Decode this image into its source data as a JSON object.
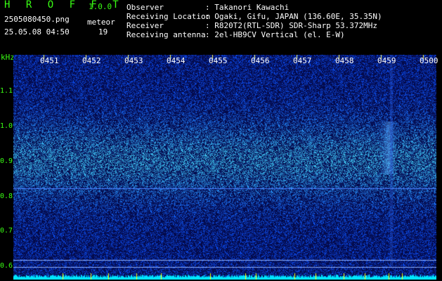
{
  "header": {
    "app_title": "H R O F F T",
    "app_version": "1.0.0",
    "file_name": "2505080450.png",
    "timestamp": "25.05.08 04:50",
    "meteor_label": "meteor",
    "meteor_count": "19"
  },
  "info": [
    {
      "key": "Observer",
      "value": ": Takanori Kawachi"
    },
    {
      "key": "Receiving Location",
      "value": ": Ogaki, Gifu, JAPAN (136.60E, 35.35N)"
    },
    {
      "key": "Receiver",
      "value": ": R820T2(RTL-SDR) SDR-Sharp 53.372MHz"
    },
    {
      "key": "Receiving antenna",
      "value": ": 2el-HB9CV Vertical (el. E-W)"
    }
  ],
  "axis": {
    "unit": "kHz",
    "y_ticks": [
      "1.1",
      "1.0",
      "0.9",
      "0.8",
      "0.7",
      "0.6"
    ],
    "x_ticks": [
      "0451",
      "0452",
      "0453",
      "0454",
      "0455",
      "0456",
      "0457",
      "0458",
      "0459",
      "0500"
    ]
  },
  "colors": {
    "background": "#000000",
    "noise_base": "#07126e",
    "signal": "#2a7bff",
    "trace": "#00e5ff",
    "spike": "#ffff00",
    "grid": "#0050ff",
    "label_green": "#39ff14"
  }
}
